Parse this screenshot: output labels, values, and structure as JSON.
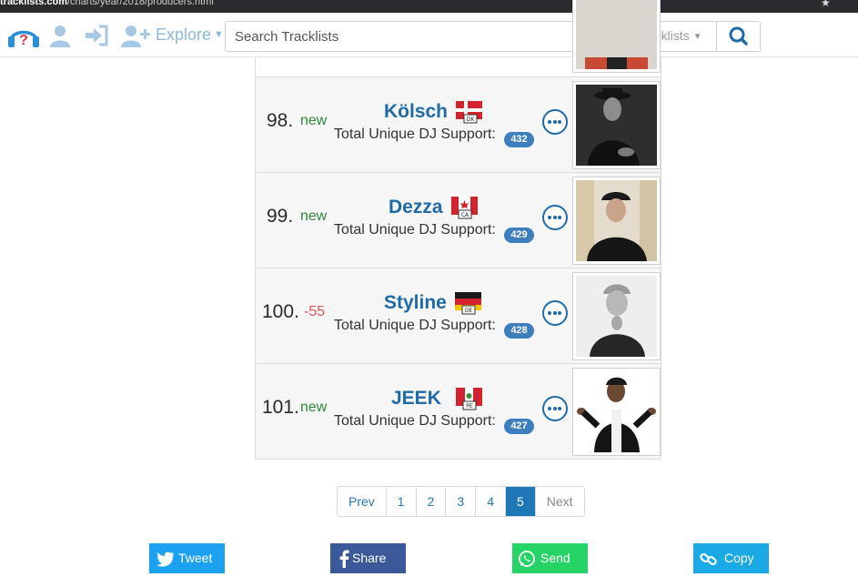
{
  "browser": {
    "url_domain": "tracklists.com",
    "url_path": "/charts/year/2018/producers.html"
  },
  "nav": {
    "explore_label": "Explore",
    "search_placeholder": "Search Tracklists",
    "search_category": "Tracklists"
  },
  "chart_rows": [
    {
      "rank": "98.",
      "change": "new",
      "change_type": "new",
      "name": "Kölsch",
      "flag_code": "DK",
      "support_label": "Total Unique DJ Support:",
      "support_count": "432"
    },
    {
      "rank": "99.",
      "change": "new",
      "change_type": "new",
      "name": "Dezza",
      "flag_code": "CA",
      "support_label": "Total Unique DJ Support:",
      "support_count": "429"
    },
    {
      "rank": "100.",
      "change": "-55",
      "change_type": "down",
      "name": "Styline",
      "flag_code": "DE",
      "support_label": "Total Unique DJ Support:",
      "support_count": "428"
    },
    {
      "rank": "101.",
      "change": "new",
      "change_type": "new",
      "name": "JEEK",
      "flag_code": "PE",
      "support_label": "Total Unique DJ Support:",
      "support_count": "427"
    }
  ],
  "pagination": {
    "prev": "Prev",
    "pages": [
      "1",
      "2",
      "3",
      "4",
      "5"
    ],
    "active_page": "5",
    "next": "Next"
  },
  "share": {
    "tweet": "Tweet",
    "share": "Share",
    "send": "Send",
    "copy": "Copy"
  },
  "colors": {
    "accent": "#1f6ba8",
    "new": "#2d8a3c",
    "down": "#e2515e",
    "twitter": "#1ca1f1",
    "facebook": "#3b5998",
    "whatsapp": "#25d366",
    "copy": "#1ba9e6"
  }
}
